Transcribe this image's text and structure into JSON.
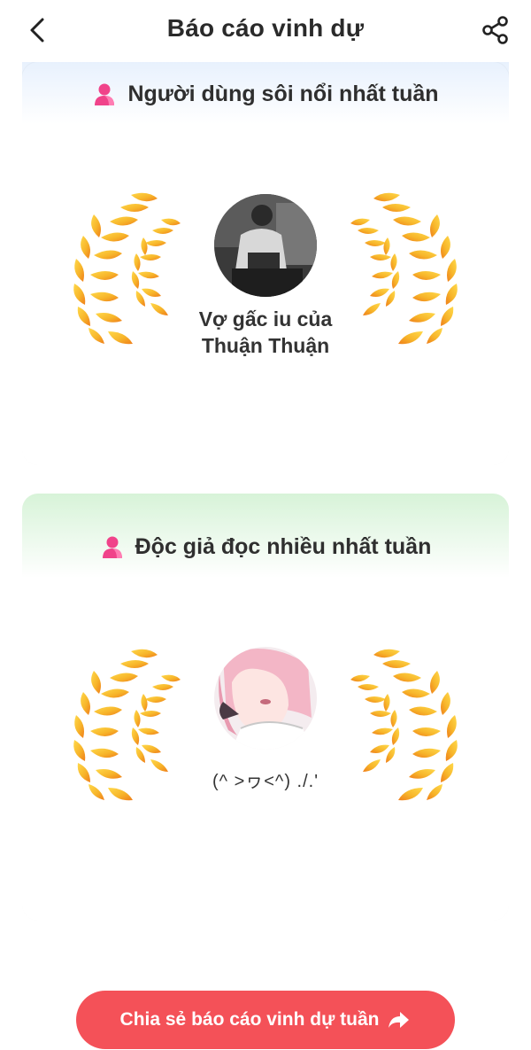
{
  "header": {
    "title": "Báo cáo vinh dự",
    "back_icon": "chevron-left-icon",
    "share_icon": "share-icon"
  },
  "cards": [
    {
      "heading": "Người dùng sôi nổi nhất tuần",
      "icon": "person-icon",
      "user_name_line1": "Vợ gấc iu của",
      "user_name_line2": "Thuận Thuận",
      "avatar": "avatar-photo"
    },
    {
      "heading": "Độc giả đọc nhiều nhất tuần",
      "icon": "person-icon",
      "user_name_line1": "(^ >ヮ<^) ./.'",
      "avatar": "avatar-anime"
    }
  ],
  "cta": {
    "label": "Chia sẻ báo cáo vinh dự tuần",
    "icon": "forward-arrow-icon"
  },
  "colors": {
    "accent": "#f45158",
    "laurel_gold": "#f7b52a",
    "laurel_orange": "#ef8a1f",
    "person_icon": "#f0438a"
  }
}
